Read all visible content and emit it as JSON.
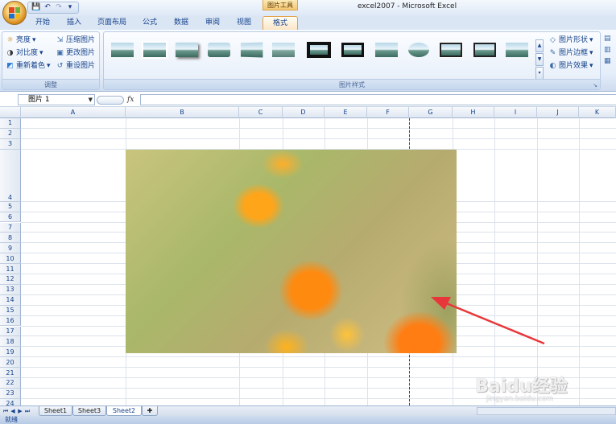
{
  "window": {
    "title": "excel2007 - Microsoft Excel",
    "context_tab": "图片工具"
  },
  "qat": {
    "save": "💾",
    "undo": "↶",
    "redo": "↷",
    "more": "▾"
  },
  "tabs": [
    "开始",
    "插入",
    "页面布局",
    "公式",
    "数据",
    "审阅",
    "视图",
    "格式"
  ],
  "ribbon": {
    "adjust": {
      "label": "调整",
      "items": [
        "亮度",
        "对比度",
        "重新着色",
        "压缩图片",
        "更改图片",
        "重设图片"
      ]
    },
    "styles": {
      "label": "图片样式"
    },
    "right_buttons": [
      "图片形状",
      "图片边框",
      "图片效果"
    ]
  },
  "formula_bar": {
    "name_box": "图片 1",
    "fx": "fx",
    "value": ""
  },
  "columns": [
    "A",
    "B",
    "C",
    "D",
    "E",
    "F",
    "G",
    "H",
    "I",
    "J",
    "K"
  ],
  "rows": [
    "1",
    "2",
    "3",
    "4",
    "5",
    "6",
    "7",
    "8",
    "9",
    "10",
    "11",
    "12",
    "13",
    "14",
    "15",
    "16",
    "17",
    "18",
    "19",
    "20",
    "21",
    "22",
    "23",
    "24"
  ],
  "sheets": [
    "Sheet1",
    "Sheet3",
    "Sheet2"
  ],
  "active_sheet": "Sheet2",
  "status": {
    "text": "就绪"
  },
  "watermark": {
    "text": "Baidu经验",
    "url": "jingyan.baidu.com"
  },
  "colors": {
    "accent": "#15428b",
    "context": "#f4c674",
    "arrow": "#e8373a"
  }
}
